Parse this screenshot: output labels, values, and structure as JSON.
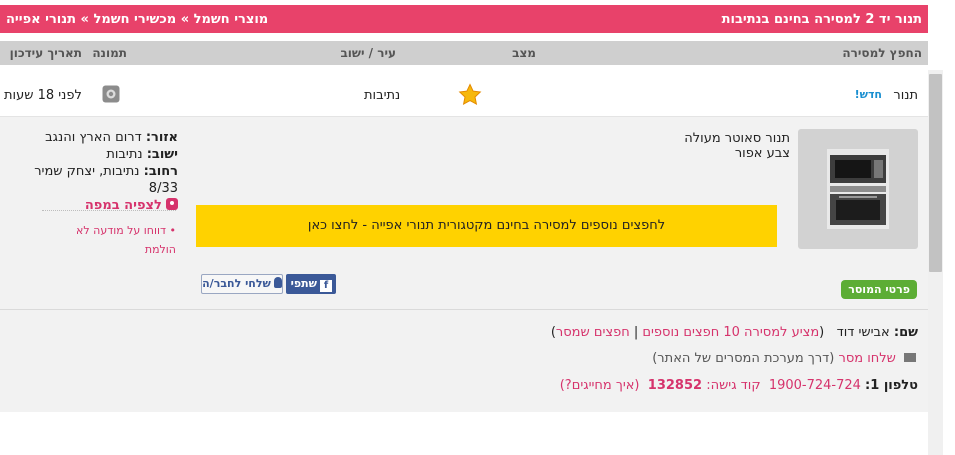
{
  "breadcrumb": {
    "title": "תנור יד 2 למסירה בחינם בנתיבות",
    "path": "מוצרי חשמל » מכשירי חשמל » תנורי אפייה"
  },
  "columns": {
    "item": "החפץ למסירה",
    "condition": "מצב",
    "city": "עיר / ישוב",
    "image": "תמונה",
    "updated": "תאריך עידכון"
  },
  "listing": {
    "item_name": "תנור",
    "new_badge": "חדש!",
    "city": "נתיבות",
    "updated": "לפני 18 שעות",
    "star_icon": "star-icon",
    "camera_icon": "camera-icon"
  },
  "details": {
    "description_line1": "תנור סאוטר מעולה",
    "description_line2": "צבע אפור",
    "area_label": "אזור:",
    "area_value": "דרום הארץ והנגב",
    "town_label": "ישוב:",
    "town_value": "נתיבות",
    "street_label": "רחוב:",
    "street_value": "נתיבות, יצחק שמיר 8/33",
    "map_link": "לצפיה במפה",
    "report_link": "דווחו על מודעה לא הולמת",
    "promo_text": "לחפצים נוספים למסירה בחינם מקטגורית תנורי אפייה - לחצו כאן",
    "seller_details_button": "פרטי המוסר",
    "share_button": "שתפי",
    "send_friend_button": "שלחי לחבר/ה"
  },
  "seller": {
    "name_label": "שם:",
    "name_value": "אבישי דוד",
    "open_paren": "(",
    "more_items_link": "מציע למסירה 10 חפצים נוספים",
    "separator": "|",
    "saved_items_link": "חפצים שמסר",
    "close_paren": ")",
    "send_message_link": "שלחו מסר",
    "send_message_note": "(דרך מערכת המסרים של האתר)",
    "phone_label": "טלפון 1:",
    "phone_number": "1900-724-724",
    "access_code_label": "קוד גישה:",
    "access_code": "132852",
    "billing_link": "(איך מחייגים?)"
  },
  "colors": {
    "titlebar": "#e8426a",
    "promo": "#ffd200",
    "green_button": "#5cad35",
    "facebook": "#3b5998"
  }
}
